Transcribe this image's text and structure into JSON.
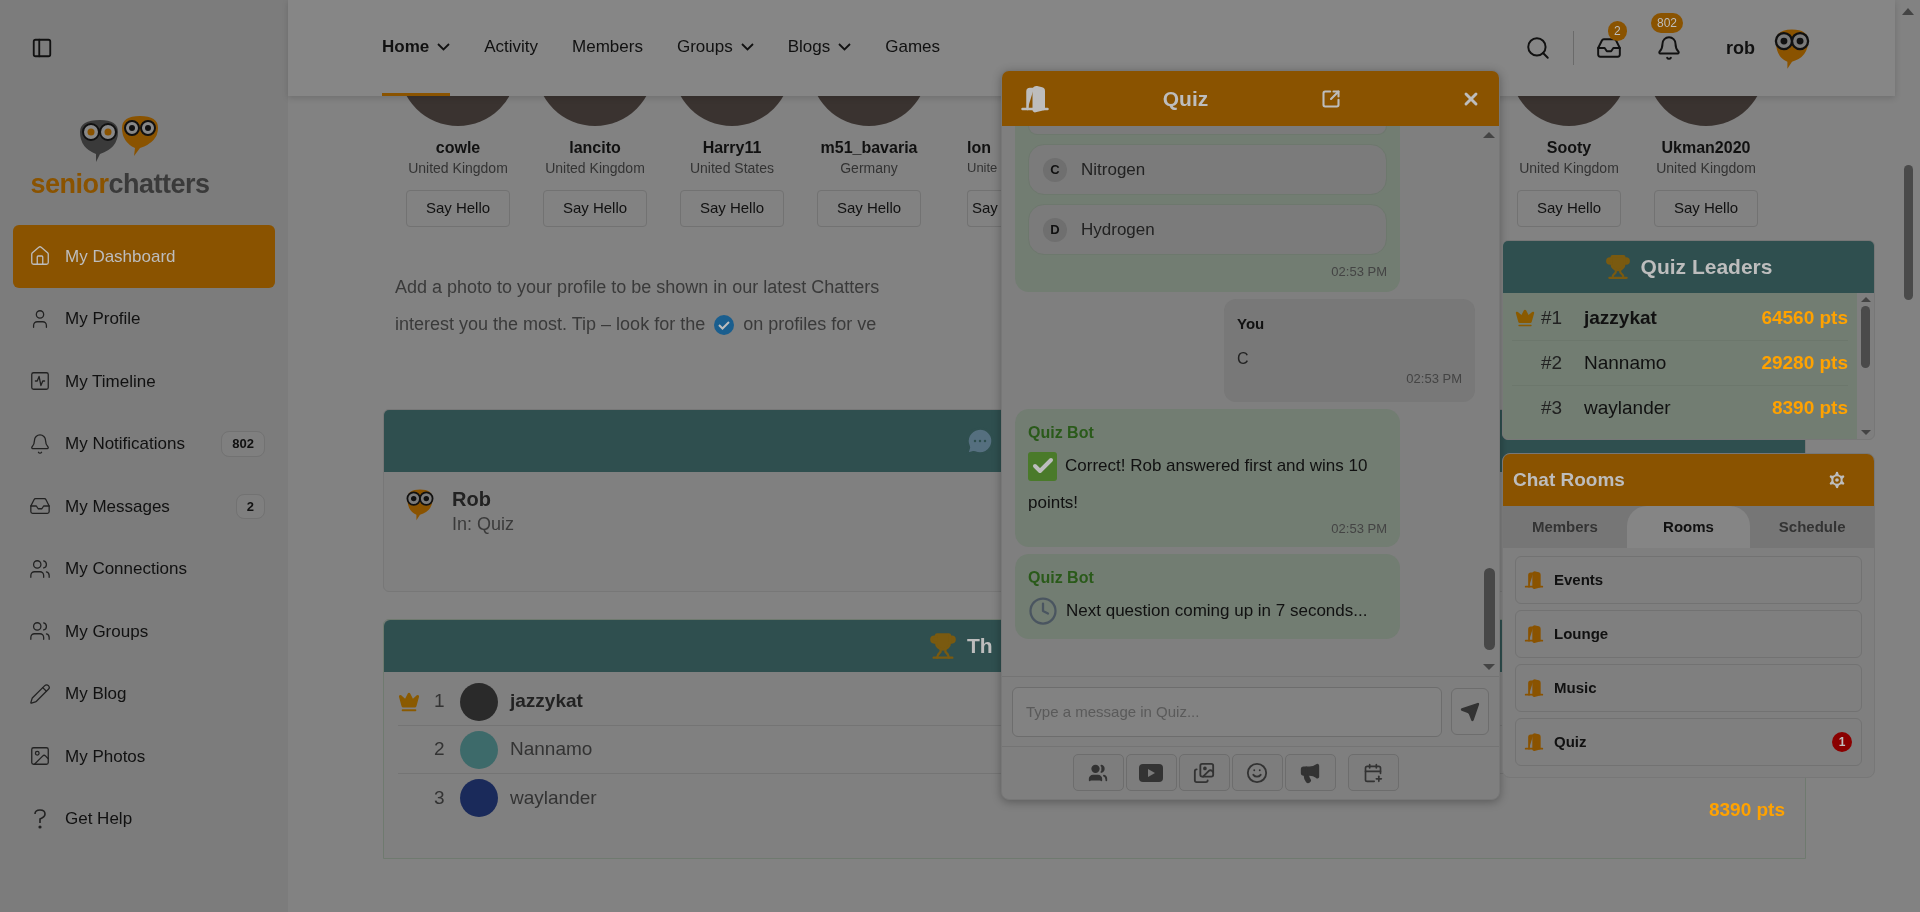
{
  "logo": {
    "first": "senior",
    "second": "chatters"
  },
  "sidebar": {
    "items": [
      {
        "label": "My Dashboard",
        "selected": true
      },
      {
        "label": "My Profile",
        "selected": false
      },
      {
        "label": "My Timeline",
        "selected": false
      },
      {
        "label": "My Notifications",
        "selected": false,
        "badge": "802"
      },
      {
        "label": "My Messages",
        "selected": false,
        "badge": "2"
      },
      {
        "label": "My Connections",
        "selected": false
      },
      {
        "label": "My Groups",
        "selected": false
      },
      {
        "label": "My Blog",
        "selected": false
      },
      {
        "label": "My Photos",
        "selected": false
      },
      {
        "label": "Get Help",
        "selected": false
      }
    ]
  },
  "nav": {
    "items": [
      {
        "label": "Home",
        "dropdown": true,
        "selected": true
      },
      {
        "label": "Activity",
        "dropdown": false,
        "selected": false
      },
      {
        "label": "Members",
        "dropdown": false,
        "selected": false
      },
      {
        "label": "Groups",
        "dropdown": true,
        "selected": false
      },
      {
        "label": "Blogs",
        "dropdown": true,
        "selected": false
      },
      {
        "label": "Games",
        "dropdown": false,
        "selected": false
      }
    ],
    "messages_badge": "2",
    "notifications_badge": "802",
    "username": "rob"
  },
  "members": [
    {
      "name": "cowle",
      "country": "United Kingdom",
      "button": "Say Hello",
      "cut": false
    },
    {
      "name": "lancito",
      "country": "United Kingdom",
      "button": "Say Hello",
      "cut": false
    },
    {
      "name": "Harry11",
      "country": "United States",
      "button": "Say Hello",
      "cut": false
    },
    {
      "name": "m51_bavaria",
      "country": "Germany",
      "button": "Say Hello",
      "cut": false
    },
    {
      "name": "lon",
      "country": "Unite",
      "button": "Say",
      "cut": true
    },
    {
      "name": "Sooty",
      "country": "United Kingdom",
      "button": "Say Hello",
      "cut": false
    },
    {
      "name": "Ukman2020",
      "country": "United Kingdom",
      "button": "Say Hello",
      "cut": false
    }
  ],
  "intro": {
    "line1": "Add a photo to your profile to be shown in our latest Chatters",
    "line2_before": "interest you the most. Tip – look for the",
    "line2_after": "on profiles for ve"
  },
  "activity_card": {
    "name": "Rob",
    "location": "In: Quiz"
  },
  "leaders_card": {
    "title": "Th",
    "rows": [
      {
        "rank": "1",
        "name": "jazzykat",
        "crown": true
      },
      {
        "rank": "2",
        "name": "Nannamo",
        "crown": false
      },
      {
        "rank": "3",
        "name": "waylander",
        "crown": false,
        "points": "8390 pts"
      }
    ]
  },
  "chat_window": {
    "title": "Quiz",
    "messages": [
      {
        "kind": "options",
        "options": [
          {
            "letter": "C",
            "text": "Nitrogen"
          },
          {
            "letter": "D",
            "text": "Hydrogen"
          }
        ],
        "time": "02:53 PM"
      },
      {
        "kind": "own",
        "sender": "You",
        "text": "C",
        "time": "02:53 PM"
      },
      {
        "kind": "bot",
        "sender": "Quiz Bot",
        "text": "Correct! Rob answered first and wins 10 points!",
        "time": "02:53 PM"
      },
      {
        "kind": "bot",
        "sender": "Quiz Bot",
        "text": "Next question coming up in 7 seconds..."
      }
    ],
    "input": {
      "placeholder": "Type a message in Quiz..."
    }
  },
  "quiz_leaders": {
    "title": "Quiz Leaders",
    "rows": [
      {
        "rank": "#1",
        "name": "jazzykat",
        "points": "64560 pts",
        "crown": true
      },
      {
        "rank": "#2",
        "name": "Nannamo",
        "points": "29280 pts",
        "crown": false
      },
      {
        "rank": "#3",
        "name": "waylander",
        "points": "8390 pts",
        "crown": false
      }
    ]
  },
  "chat_rooms": {
    "title": "Chat Rooms",
    "tabs": [
      {
        "label": "Members",
        "selected": false
      },
      {
        "label": "Rooms",
        "selected": true
      },
      {
        "label": "Schedule",
        "selected": false
      }
    ],
    "rooms": [
      {
        "name": "Events"
      },
      {
        "name": "Lounge"
      },
      {
        "name": "Music"
      },
      {
        "name": "Quiz",
        "badge": "1"
      }
    ]
  }
}
